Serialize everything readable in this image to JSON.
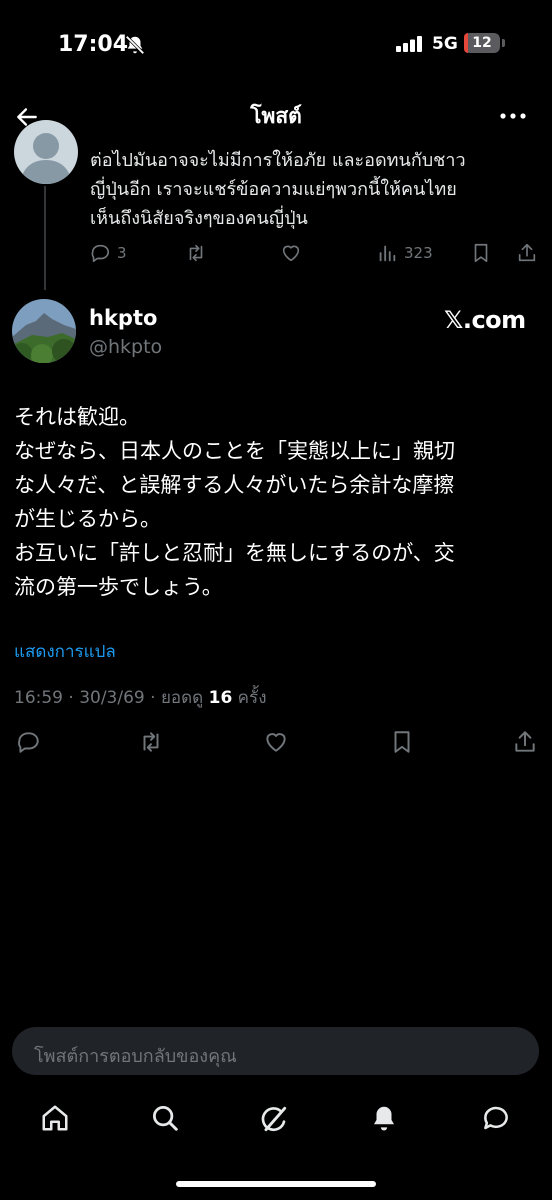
{
  "status_bar": {
    "time": "17:04",
    "network": "5G",
    "battery": "12",
    "battery_level_percent": 12
  },
  "header": {
    "title": "โพสต์"
  },
  "previous_post": {
    "lines": [
      "ต่อไปมันอาจจะไม่มีการให้อภัย และอดทนกับชาว",
      "ญี่ปุ่นอีก เราจะแชร์ข้อความแย่ๆพวกนี้ให้คนไทย",
      "เห็นถึงนิสัยจริงๆของคนญี่ปุ่น"
    ],
    "replies": "3",
    "views": "323"
  },
  "post": {
    "name": "hkpto",
    "handle": "@hkpto",
    "source": "𝕏.com",
    "lines": [
      "それは歓迎。",
      "なぜなら、日本人のことを「実態以上に」親切",
      "な人々だ、と誤解する人々がいたら余計な摩擦",
      "が生じるから。",
      "お互いに「許しと忍耐」を無しにするのが、交",
      "流の第一歩でしょう。"
    ],
    "translate": "แสดงการแปล",
    "meta_time": "16:59 · 30/3/69 · ยอดดู ",
    "meta_views": "16",
    "meta_suffix": " ครั้ง"
  },
  "reply_input": {
    "placeholder": "โพสต์การตอบกลับของคุณ"
  }
}
